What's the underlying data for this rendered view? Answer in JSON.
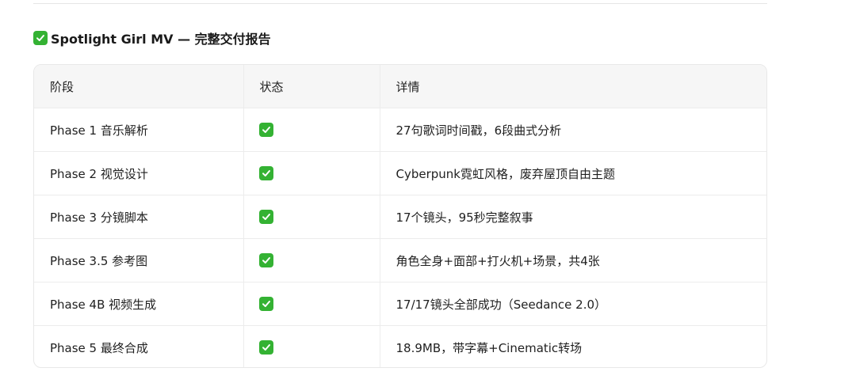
{
  "heading": {
    "icon": "check-mark-icon",
    "text": "Spotlight Girl MV — 完整交付报告"
  },
  "colors": {
    "check_green": "#34b233",
    "header_bg": "#f6f6f6",
    "border": "#ececec"
  },
  "table": {
    "headers": [
      "阶段",
      "状态",
      "详情"
    ],
    "rows": [
      {
        "phase": "Phase 1 音乐解析",
        "status": "check-mark-icon",
        "detail": "27句歌词时间戳，6段曲式分析"
      },
      {
        "phase": "Phase 2 视觉设计",
        "status": "check-mark-icon",
        "detail": "Cyberpunk霓虹风格，废弃屋顶自由主题"
      },
      {
        "phase": "Phase 3 分镜脚本",
        "status": "check-mark-icon",
        "detail": "17个镜头，95秒完整叙事"
      },
      {
        "phase": "Phase 3.5 参考图",
        "status": "check-mark-icon",
        "detail": "角色全身+面部+打火机+场景，共4张"
      },
      {
        "phase": "Phase 4B 视频生成",
        "status": "check-mark-icon",
        "detail": "17/17镜头全部成功（Seedance 2.0）"
      },
      {
        "phase": "Phase 5 最终合成",
        "status": "check-mark-icon",
        "detail": "18.9MB，带字幕+Cinematic转场"
      }
    ]
  }
}
